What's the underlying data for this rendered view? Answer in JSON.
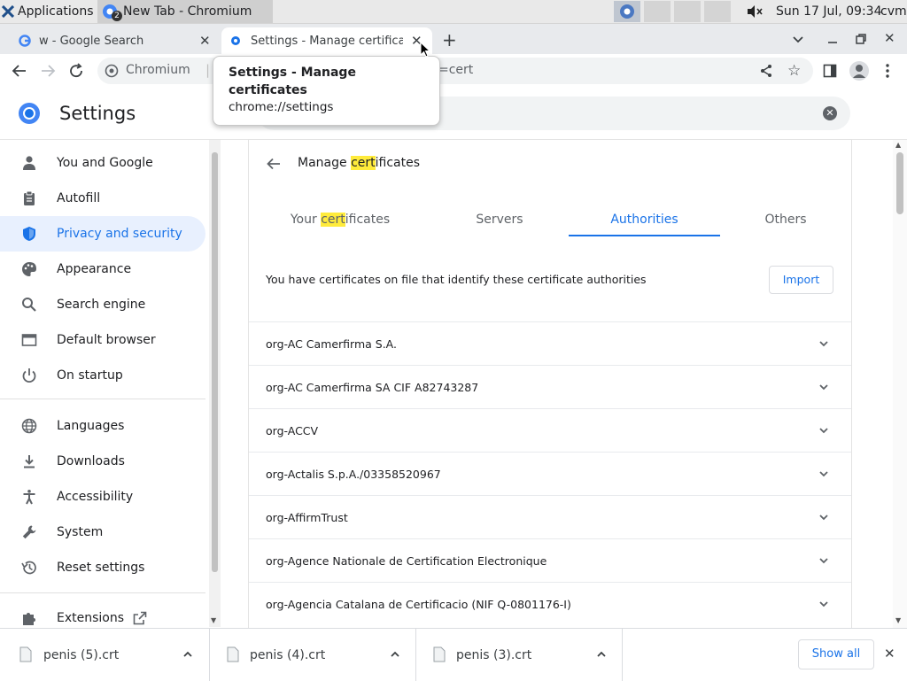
{
  "taskbar": {
    "applications_label": "Applications",
    "window_title": "New Tab - Chromium",
    "window_badge": "2",
    "datetime": "Sun 17 Jul, 09:34",
    "user": "cvm"
  },
  "tabs": [
    {
      "title": "w - Google Search"
    },
    {
      "title": "Settings - Manage certifica"
    }
  ],
  "omnibox": {
    "site_label": "Chromium",
    "url_tail": "=cert"
  },
  "tooltip": {
    "title": "Settings - Manage certificates",
    "url": "chrome://settings"
  },
  "settings": {
    "title": "Settings"
  },
  "sidebar": {
    "items": [
      {
        "label": "You and Google",
        "icon": "person-icon"
      },
      {
        "label": "Autofill",
        "icon": "clipboard-icon"
      },
      {
        "label": "Privacy and security",
        "icon": "shield-icon"
      },
      {
        "label": "Appearance",
        "icon": "palette-icon"
      },
      {
        "label": "Search engine",
        "icon": "search-icon"
      },
      {
        "label": "Default browser",
        "icon": "browser-icon"
      },
      {
        "label": "On startup",
        "icon": "power-icon"
      },
      {
        "label": "Languages",
        "icon": "globe-icon"
      },
      {
        "label": "Downloads",
        "icon": "download-icon"
      },
      {
        "label": "Accessibility",
        "icon": "accessibility-icon"
      },
      {
        "label": "System",
        "icon": "wrench-icon"
      },
      {
        "label": "Reset settings",
        "icon": "history-icon"
      },
      {
        "label": "Extensions",
        "icon": "puzzle-icon"
      }
    ]
  },
  "certificates": {
    "page_title_pre": "Manage ",
    "page_title_hl": "cert",
    "page_title_post": "ificates",
    "tabs": {
      "yours_pre": "Your ",
      "yours_hl": "cert",
      "yours_post": "ificates",
      "servers": "Servers",
      "authorities": "Authorities",
      "others": "Others"
    },
    "description": "You have certificates on file that identify these certificate authorities",
    "import_label": "Import",
    "authorities": [
      "org-AC Camerfirma S.A.",
      "org-AC Camerfirma SA CIF A82743287",
      "org-ACCV",
      "org-Actalis S.p.A./03358520967",
      "org-AffirmTrust",
      "org-Agence Nationale de Certification Electronique",
      "org-Agencia Catalana de Certificacio (NIF Q-0801176-I)"
    ]
  },
  "downloads": {
    "items": [
      "penis (5).crt",
      "penis (4).crt",
      "penis (3).crt"
    ],
    "show_all_label": "Show all"
  },
  "colors": {
    "accent": "#1a73e8",
    "highlight": "#ffeb3b",
    "selected_bg": "#e8f0fe"
  }
}
